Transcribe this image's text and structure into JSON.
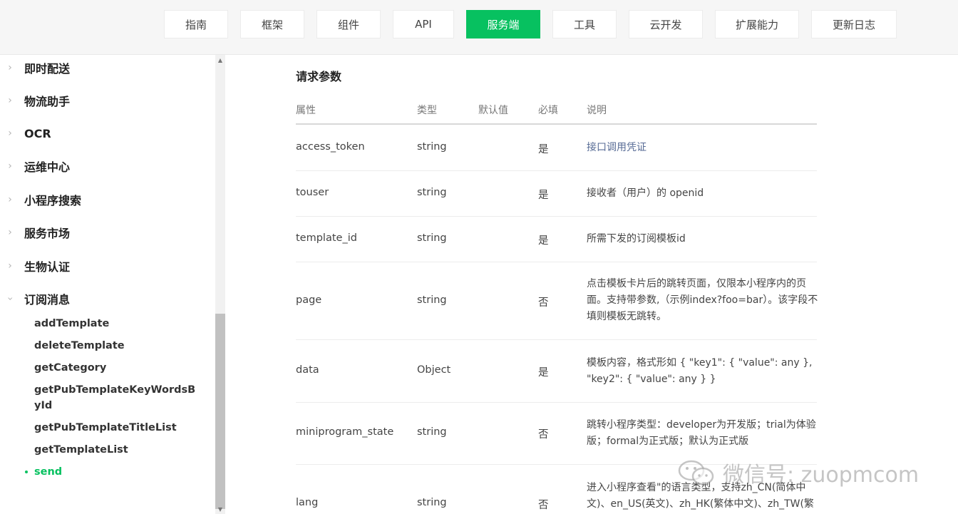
{
  "nav": {
    "tabs": [
      {
        "label": "指南"
      },
      {
        "label": "框架"
      },
      {
        "label": "组件"
      },
      {
        "label": "API"
      },
      {
        "label": "服务端",
        "active": true
      },
      {
        "label": "工具"
      },
      {
        "label": "云开发"
      },
      {
        "label": "扩展能力"
      },
      {
        "label": "更新日志"
      }
    ]
  },
  "sidebar": {
    "items": [
      {
        "label": "即时配送"
      },
      {
        "label": "物流助手"
      },
      {
        "label": "OCR"
      },
      {
        "label": "运维中心"
      },
      {
        "label": "小程序搜索"
      },
      {
        "label": "服务市场"
      },
      {
        "label": "生物认证"
      },
      {
        "label": "订阅消息",
        "expanded": true
      }
    ],
    "sub_items": [
      {
        "label": "addTemplate"
      },
      {
        "label": "deleteTemplate"
      },
      {
        "label": "getCategory"
      },
      {
        "label": "getPubTemplateKeyWordsById"
      },
      {
        "label": "getPubTemplateTitleList"
      },
      {
        "label": "getTemplateList"
      },
      {
        "label": "send",
        "active": true
      }
    ]
  },
  "main": {
    "section_title": "请求参数",
    "columns": [
      "属性",
      "类型",
      "默认值",
      "必填",
      "说明"
    ],
    "rows": [
      {
        "name": "access_token",
        "type": "string",
        "default": "",
        "required": "是",
        "desc": "接口调用凭证",
        "desc_is_link": true
      },
      {
        "name": "touser",
        "type": "string",
        "default": "",
        "required": "是",
        "desc": "接收者（用户）的 openid"
      },
      {
        "name": "template_id",
        "type": "string",
        "default": "",
        "required": "是",
        "desc": "所需下发的订阅模板id"
      },
      {
        "name": "page",
        "type": "string",
        "default": "",
        "required": "否",
        "desc": "点击模板卡片后的跳转页面，仅限本小程序内的页面。支持带参数,（示例index?foo=bar）。该字段不填则模板无跳转。"
      },
      {
        "name": "data",
        "type": "Object",
        "default": "",
        "required": "是",
        "desc": "模板内容，格式形如 { \"key1\": { \"value\": any }, \"key2\": { \"value\": any } }"
      },
      {
        "name": "miniprogram_state",
        "type": "string",
        "default": "",
        "required": "否",
        "desc": "跳转小程序类型：developer为开发版；trial为体验版；formal为正式版；默认为正式版"
      },
      {
        "name": "lang",
        "type": "string",
        "default": "",
        "required": "否",
        "desc": "进入小程序查看\"的语言类型，支持zh_CN(简体中文)、en_US(英文)、zh_HK(繁体中文)、zh_TW(繁"
      }
    ]
  },
  "watermark": {
    "text": "微信号: zuopmcom",
    "icon": "wechat-icon"
  },
  "colors": {
    "accent": "#07c160",
    "link": "#576b95"
  }
}
